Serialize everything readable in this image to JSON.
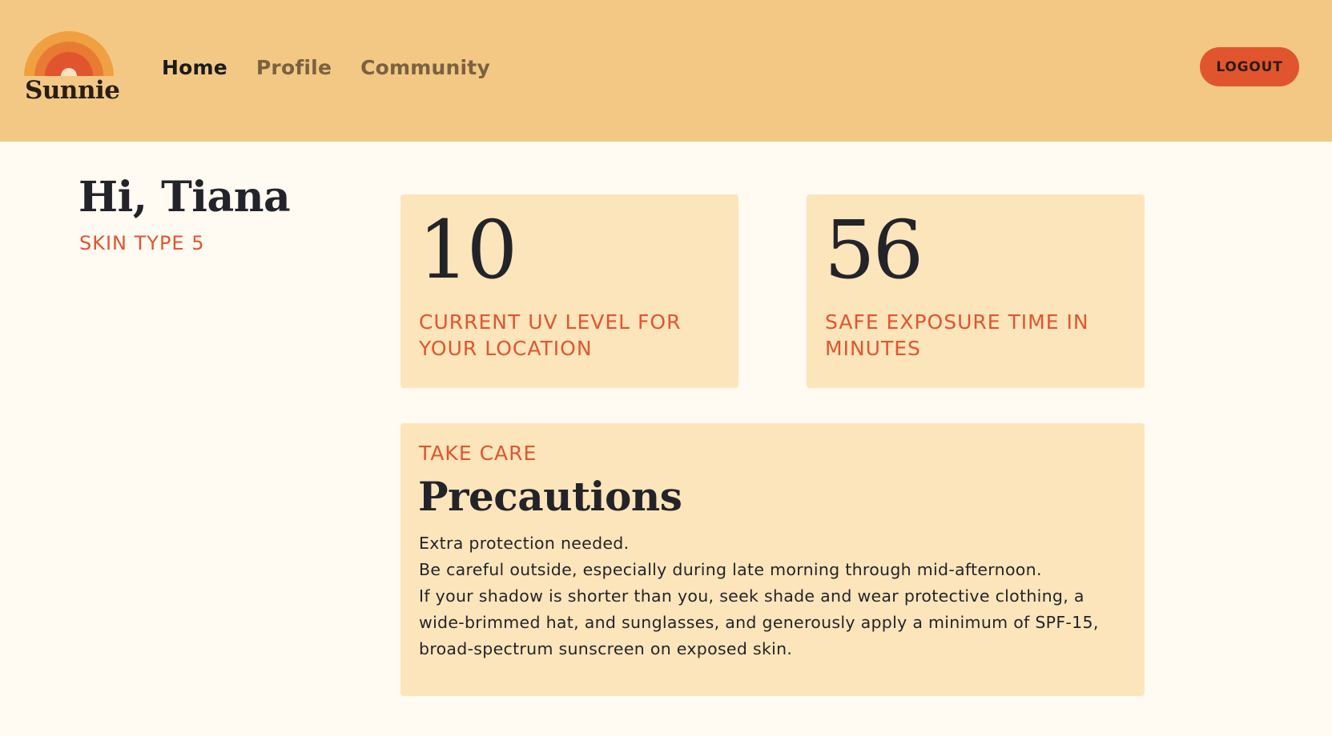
{
  "brand": {
    "name": "Sunnie",
    "colors": {
      "outer": "#f0a041",
      "middle": "#e97a33",
      "inner": "#e1552e"
    }
  },
  "nav": {
    "items": [
      {
        "label": "Home",
        "active": true
      },
      {
        "label": "Profile",
        "active": false
      },
      {
        "label": "Community",
        "active": false
      }
    ],
    "logout_label": "LOGOUT"
  },
  "user": {
    "greeting": "Hi, Tiana",
    "skin_type": "SKIN TYPE 5"
  },
  "stats": {
    "uv": {
      "value": "10",
      "label": "CURRENT UV LEVEL FOR YOUR LOCATION"
    },
    "exposure": {
      "value": "56",
      "label": "SAFE EXPOSURE TIME IN MINUTES"
    }
  },
  "precautions": {
    "eyebrow": "TAKE CARE",
    "title": "Precautions",
    "lines": [
      "Extra protection needed.",
      "Be careful outside, especially during late morning through mid-afternoon.",
      "If your shadow is shorter than you, seek shade and wear protective clothing, a wide-brimmed hat, and sunglasses, and generously apply a minimum of  SPF-15, broad-spectrum sunscreen on exposed skin."
    ]
  },
  "theme": {
    "header_bg": "#f3c884",
    "page_bg": "#fffaf2",
    "card_bg": "#fde5bb",
    "accent": "#e1552e",
    "text": "#23242a"
  }
}
